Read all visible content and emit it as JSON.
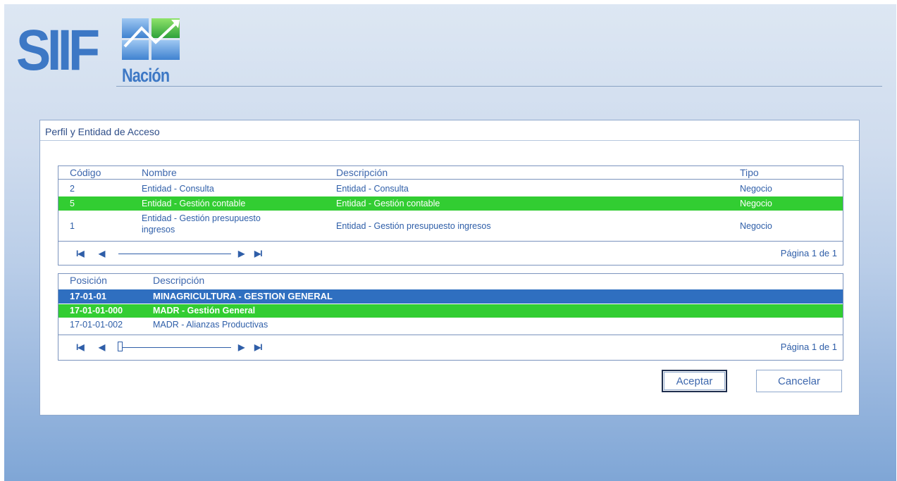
{
  "logo": {
    "main": "SIIF",
    "sub": "Nación"
  },
  "dialog": {
    "title": "Perfil y Entidad de Acceso"
  },
  "profiles": {
    "headers": {
      "codigo": "Código",
      "nombre": "Nombre",
      "descripcion": "Descripción",
      "tipo": "Tipo"
    },
    "rows": [
      {
        "codigo": "2",
        "nombre": "Entidad - Consulta",
        "descripcion": "Entidad - Consulta",
        "tipo": "Negocio"
      },
      {
        "codigo": "5",
        "nombre": "Entidad - Gestión contable",
        "descripcion": "Entidad - Gestión contable",
        "tipo": "Negocio"
      },
      {
        "codigo": "1",
        "nombre_line1": "Entidad - Gestión presupuesto",
        "nombre_line2": "ingresos",
        "descripcion": "Entidad - Gestión presupuesto ingresos",
        "tipo": "Negocio"
      }
    ],
    "pager": {
      "first": "I◀",
      "prev": "◀",
      "next": "▶",
      "last": "▶I",
      "info": "Página 1 de 1"
    }
  },
  "positions": {
    "headers": {
      "posicion": "Posición",
      "descripcion": "Descripción"
    },
    "rows": [
      {
        "posicion": "17-01-01",
        "descripcion": "MINAGRICULTURA - GESTION GENERAL"
      },
      {
        "posicion": "17-01-01-000",
        "descripcion": "MADR - Gestión General"
      },
      {
        "posicion": "17-01-01-002",
        "descripcion": "MADR - Alianzas Productivas"
      }
    ],
    "pager": {
      "first": "I◀",
      "prev": "◀",
      "next": "▶",
      "last": "▶I",
      "info": "Página 1 de 1"
    }
  },
  "buttons": {
    "accept": "Aceptar",
    "cancel": "Cancelar"
  },
  "colors": {
    "selection_green": "#32cd32",
    "selection_blue": "#2f6fc0",
    "text_blue": "#2e5ea8"
  }
}
